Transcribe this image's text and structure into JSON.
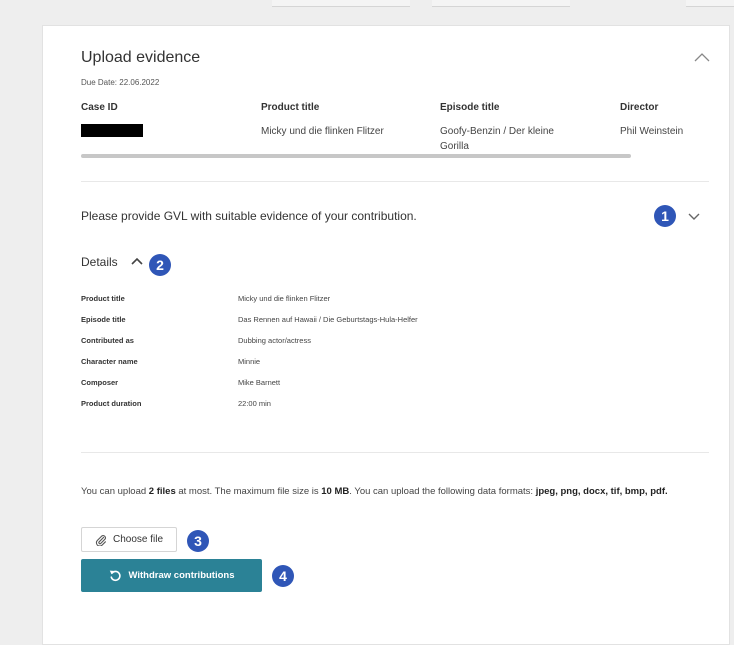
{
  "card": {
    "title": "Upload evidence",
    "due_date": "Due Date: 22.06.2022"
  },
  "case_table": {
    "headers": [
      "Case ID",
      "Product title",
      "Episode title",
      "Director"
    ],
    "row": {
      "case_id": "",
      "product_title": "Micky und die flinken Flitzer",
      "episode_title_line1": "Goofy-Benzin / Der kleine",
      "episode_title_line2": "Gorilla",
      "director": "Phil Weinstein"
    }
  },
  "evidence_section": {
    "prompt": "Please provide GVL with suitable evidence of your contribution."
  },
  "details": {
    "label": "Details",
    "rows": [
      {
        "key": "Product title",
        "value": "Micky und die flinken Flitzer"
      },
      {
        "key": "Episode title",
        "value": "Das Rennen auf Hawaii / Die Geburtstags-Hula-Helfer"
      },
      {
        "key": "Contributed as",
        "value": "Dubbing actor/actress"
      },
      {
        "key": "Character name",
        "value": "Minnie"
      },
      {
        "key": "Composer",
        "value": "Mike Barnett"
      },
      {
        "key": "Product duration",
        "value": "22:00 min"
      }
    ]
  },
  "upload": {
    "text_1": "You can upload ",
    "files_bold": "2 files",
    "text_2": " at most. The maximum file size is ",
    "size_bold": "10 MB",
    "text_3": ". You can upload the following data formats: ",
    "formats_bold": "jpeg, png, docx, tif, bmp, pdf.",
    "choose_file_label": "Choose file",
    "withdraw_label": "Withdraw contributions"
  },
  "markers": [
    "1",
    "2",
    "3",
    "4"
  ],
  "colors": {
    "marker": "#2f56b7",
    "withdraw_button": "#2b8296",
    "redaction": "#000000"
  },
  "icons": {
    "collapse": "chevron-up-icon",
    "expand": "chevron-down-icon",
    "details_toggle": "chevron-up-icon",
    "choose_file": "paperclip-icon",
    "withdraw": "undo-icon"
  }
}
